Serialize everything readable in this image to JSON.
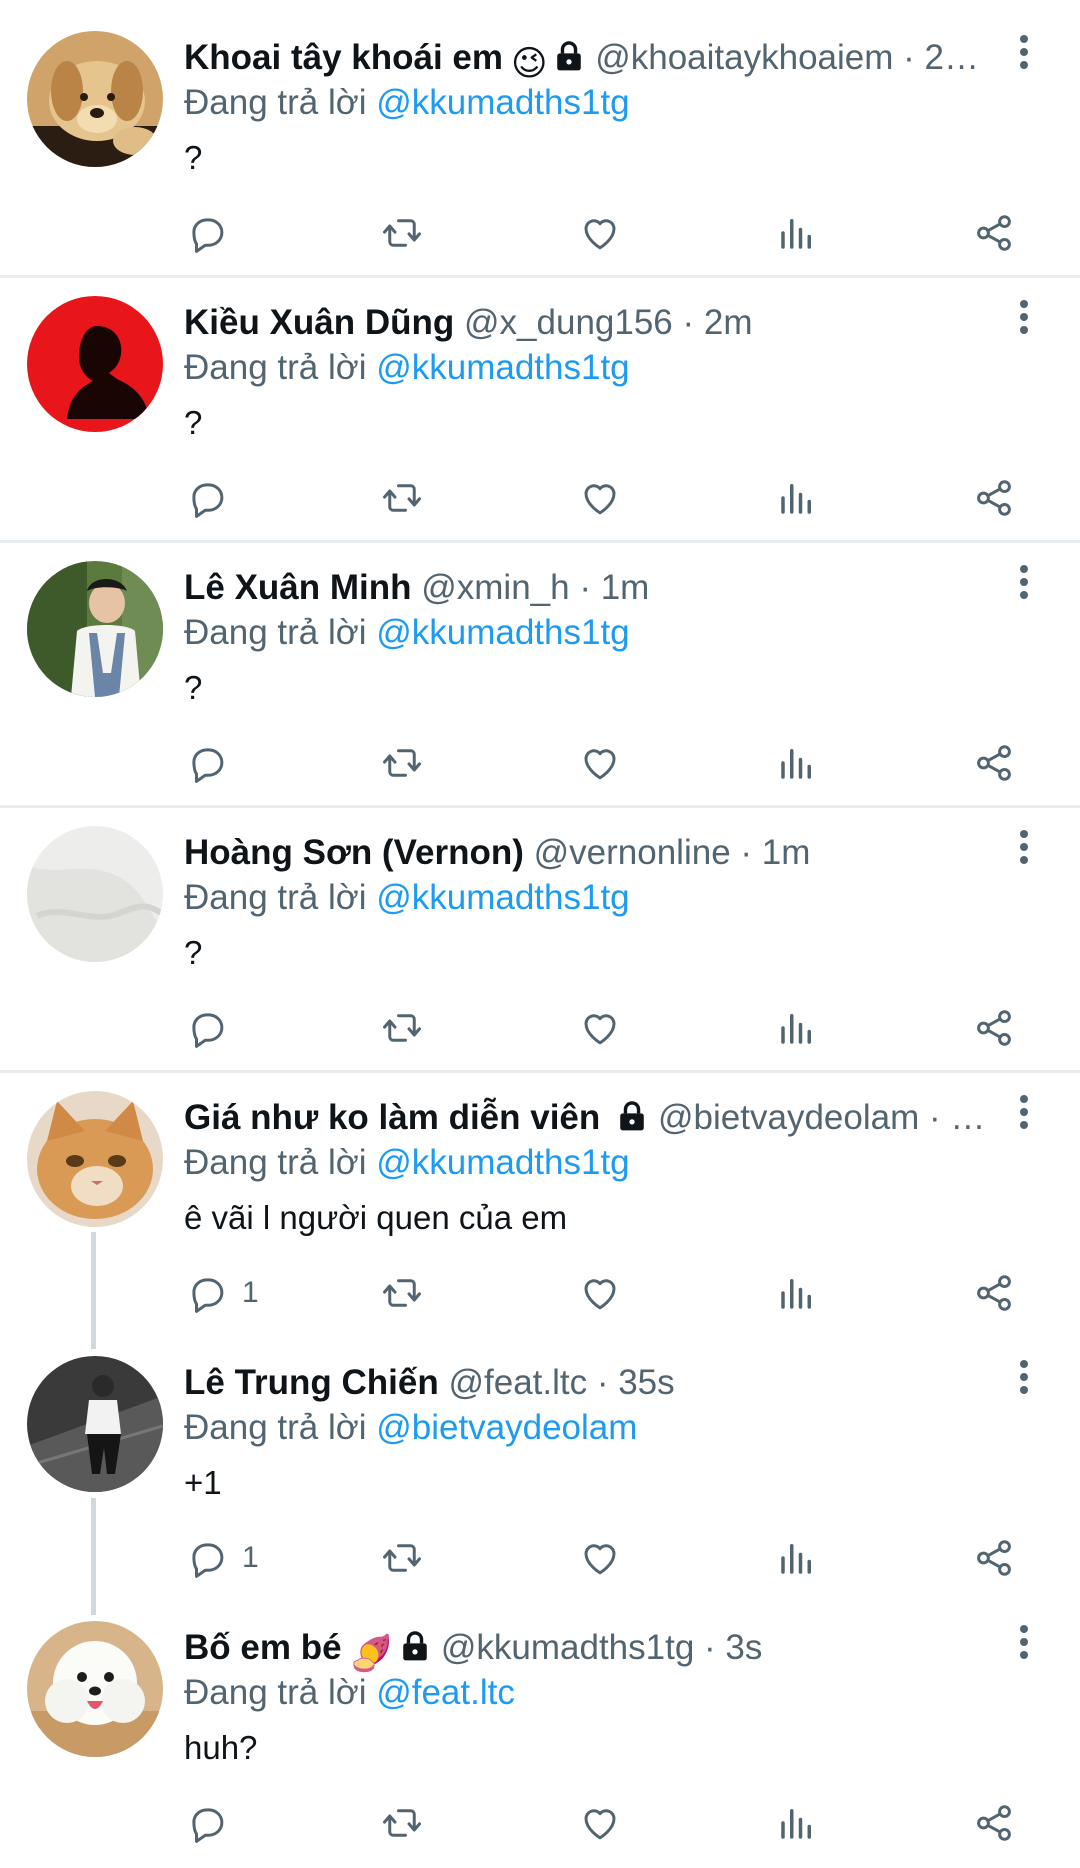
{
  "reply_prefix": "Đang trả lời",
  "tweets": [
    {
      "name": "Khoai tây khoái em",
      "emoji": "😉",
      "locked": true,
      "handle": "@khoaitaykhoaiem",
      "time": "2…",
      "reply_to": "@kkumadths1tg",
      "text": "?",
      "reply_count": ""
    },
    {
      "name": "Kiều Xuân Dũng",
      "locked": false,
      "handle": "@x_dung156",
      "time": "2m",
      "reply_to": "@kkumadths1tg",
      "text": "?",
      "reply_count": ""
    },
    {
      "name": "Lê Xuân Minh",
      "locked": false,
      "handle": "@xmin_h",
      "time": "1m",
      "reply_to": "@kkumadths1tg",
      "text": "?",
      "reply_count": ""
    },
    {
      "name": "Hoàng Sơn (Vernon)",
      "locked": false,
      "handle": "@vernonline",
      "time": "1m",
      "reply_to": "@kkumadths1tg",
      "text": "?",
      "reply_count": ""
    },
    {
      "name": "Giá như ko làm diễn viên",
      "locked": true,
      "handle": "@bietvaydeolam",
      "time": "…",
      "reply_to": "@kkumadths1tg",
      "text": "ê vãi l người quen của em",
      "reply_count": "1"
    },
    {
      "name": "Lê Trung Chiến",
      "locked": false,
      "handle": "@feat.ltc",
      "time": "35s",
      "reply_to": "@bietvaydeolam",
      "text": "+1",
      "reply_count": "1"
    },
    {
      "name": "Bố em bé",
      "emoji": "🍠",
      "locked": true,
      "handle": "@kkumadths1tg",
      "time": "3s",
      "reply_to": "@feat.ltc",
      "text": "huh?",
      "reply_count": ""
    }
  ],
  "colors": {
    "link": "#1d9bf0",
    "secondary_text": "#536471",
    "primary_text": "#0f1419",
    "divider": "#e6ecf0",
    "thread_line": "#cfd9de"
  },
  "icons": {
    "reply": "reply-icon",
    "retweet": "retweet-icon",
    "like": "like-icon",
    "views": "views-icon",
    "share": "share-icon",
    "more": "more-vertical-icon",
    "lock": "lock-icon"
  }
}
